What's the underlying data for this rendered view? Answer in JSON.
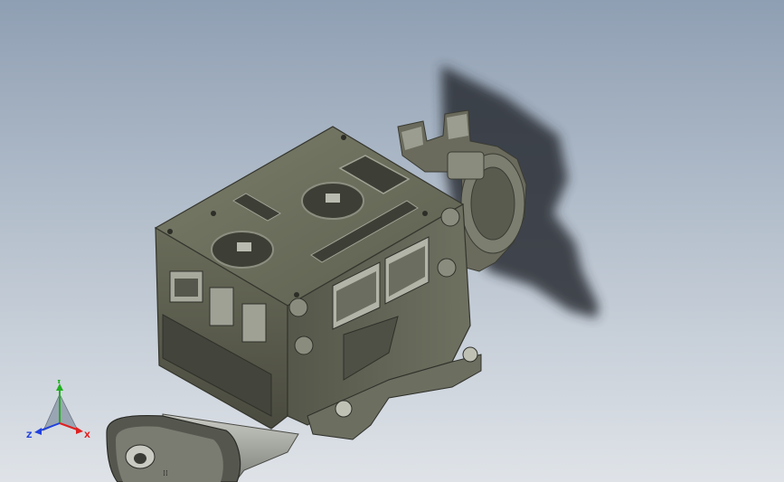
{
  "viewport": {
    "background_top": "#8f9fb3",
    "background_bottom": "#dfe3e8",
    "model_color": "#5e604f",
    "shadow_color": "#2b2d34"
  },
  "triad": {
    "x_label": "X",
    "y_label": "Y",
    "z_label": "Z",
    "x_color": "#e02020",
    "y_color": "#20b020",
    "z_color": "#2040e0"
  }
}
